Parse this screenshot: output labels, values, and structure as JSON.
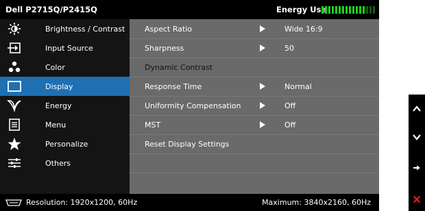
{
  "title_bar": {
    "model": "Dell P2715Q/P2415Q",
    "energy_label": "Energy Use",
    "energy_level": 0.8
  },
  "sidebar": {
    "items": [
      {
        "label": "Brightness / Contrast",
        "icon": "brightness-icon"
      },
      {
        "label": "Input Source",
        "icon": "input-source-icon"
      },
      {
        "label": "Color",
        "icon": "color-icon"
      },
      {
        "label": "Display",
        "icon": "display-icon",
        "selected": true
      },
      {
        "label": "Energy",
        "icon": "energy-icon"
      },
      {
        "label": "Menu",
        "icon": "menu-icon"
      },
      {
        "label": "Personalize",
        "icon": "star-icon"
      },
      {
        "label": "Others",
        "icon": "sliders-icon"
      }
    ]
  },
  "display_menu": {
    "rows": [
      {
        "label": "Aspect Ratio",
        "value": "Wide 16:9"
      },
      {
        "label": "Sharpness",
        "value": "50"
      },
      {
        "label": "Dynamic Contrast"
      },
      {
        "label": "Response Time",
        "value": "Normal"
      },
      {
        "label": "Uniformity Compensation",
        "value": "Off"
      },
      {
        "label": "MST",
        "value": "Off"
      },
      {
        "label": "Reset Display Settings"
      }
    ]
  },
  "status_bar": {
    "resolution": "Resolution: 1920x1200, 60Hz",
    "maximum": "Maximum: 3840x2160, 60Hz"
  },
  "buttons": [
    {
      "icon": "chevron-up-icon"
    },
    {
      "icon": "chevron-down-icon"
    },
    {
      "icon": "arrow-right-icon"
    },
    {
      "icon": "close-icon"
    }
  ],
  "colors": {
    "selected": "#1f6fb3",
    "energy_on": "#19d219",
    "energy_off": "#0c5e0c",
    "close": "#e0201b"
  }
}
